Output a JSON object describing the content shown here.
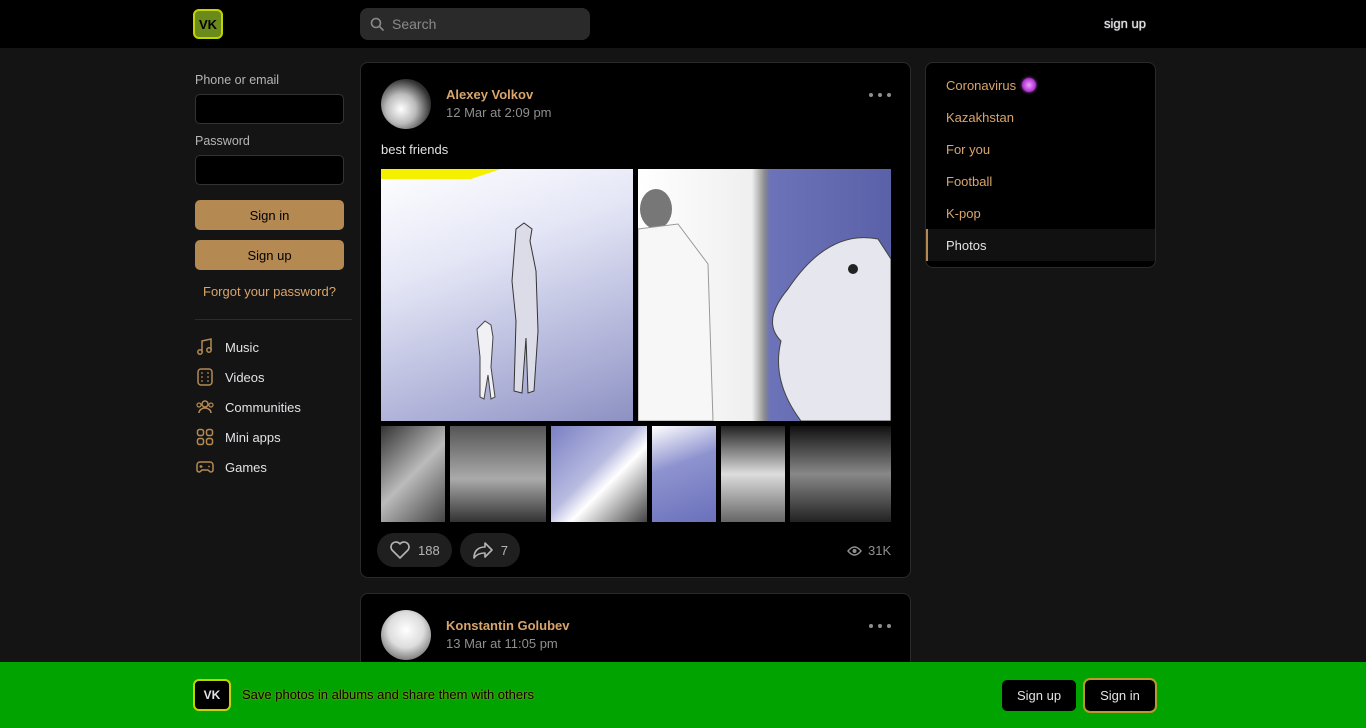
{
  "header": {
    "logo": "VK",
    "search_placeholder": "Search",
    "signup": "sign up"
  },
  "login": {
    "phone_label": "Phone or email",
    "password_label": "Password",
    "signin": "Sign in",
    "signup": "Sign up",
    "forgot": "Forgot your password?"
  },
  "nav": [
    {
      "label": "Music",
      "icon": "music-icon"
    },
    {
      "label": "Videos",
      "icon": "video-icon"
    },
    {
      "label": "Communities",
      "icon": "communities-icon"
    },
    {
      "label": "Mini apps",
      "icon": "mini-apps-icon"
    },
    {
      "label": "Games",
      "icon": "gamepad-icon"
    }
  ],
  "posts": [
    {
      "author": "Alexey Volkov",
      "date": "12 Mar at 2:09 pm",
      "text": "best friends",
      "likes": "188",
      "shares": "7",
      "views": "31K"
    },
    {
      "author": "Konstantin Golubev",
      "date": "13 Mar at 11:05 pm"
    }
  ],
  "topics": [
    {
      "label": "Coronavirus"
    },
    {
      "label": "Kazakhstan"
    },
    {
      "label": "For you"
    },
    {
      "label": "Football"
    },
    {
      "label": "K-pop"
    },
    {
      "label": "Photos",
      "active": true
    }
  ],
  "banner": {
    "logo": "VK",
    "text": "Save photos in albums and share them with others",
    "signup": "Sign up",
    "signin": "Sign in"
  },
  "colors": {
    "accent": "#b58a52",
    "link": "#d9a56c",
    "banner": "#00a300"
  }
}
